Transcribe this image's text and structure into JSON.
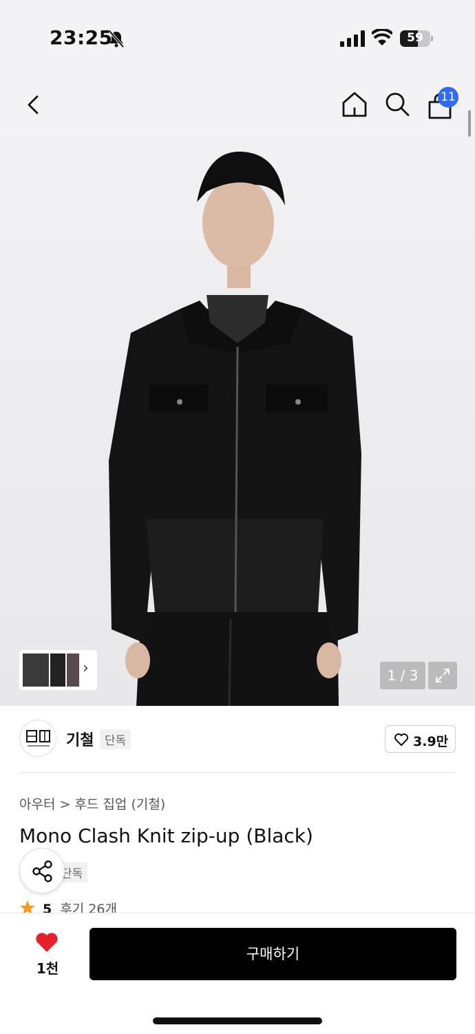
{
  "status": {
    "time": "23:25",
    "battery": "59",
    "battery_level": 0.59
  },
  "header": {
    "cart_count": "11"
  },
  "gallery": {
    "page": "1 / 3"
  },
  "brand": {
    "name": "기철",
    "tag": "단독",
    "likes": "3.9만"
  },
  "product": {
    "breadcrumb": "아우터 > 후드 집업 (기철)",
    "title": "Mono Clash Knit zip-up (Black)",
    "tag": "단독",
    "rating": "5",
    "reviews": "후기 26개"
  },
  "bottom": {
    "fav_count": "1천",
    "buy_label": "구매하기"
  },
  "colors": {
    "accent": "#2f6bf2",
    "heart": "#e8202a",
    "star": "#f59b1c"
  }
}
